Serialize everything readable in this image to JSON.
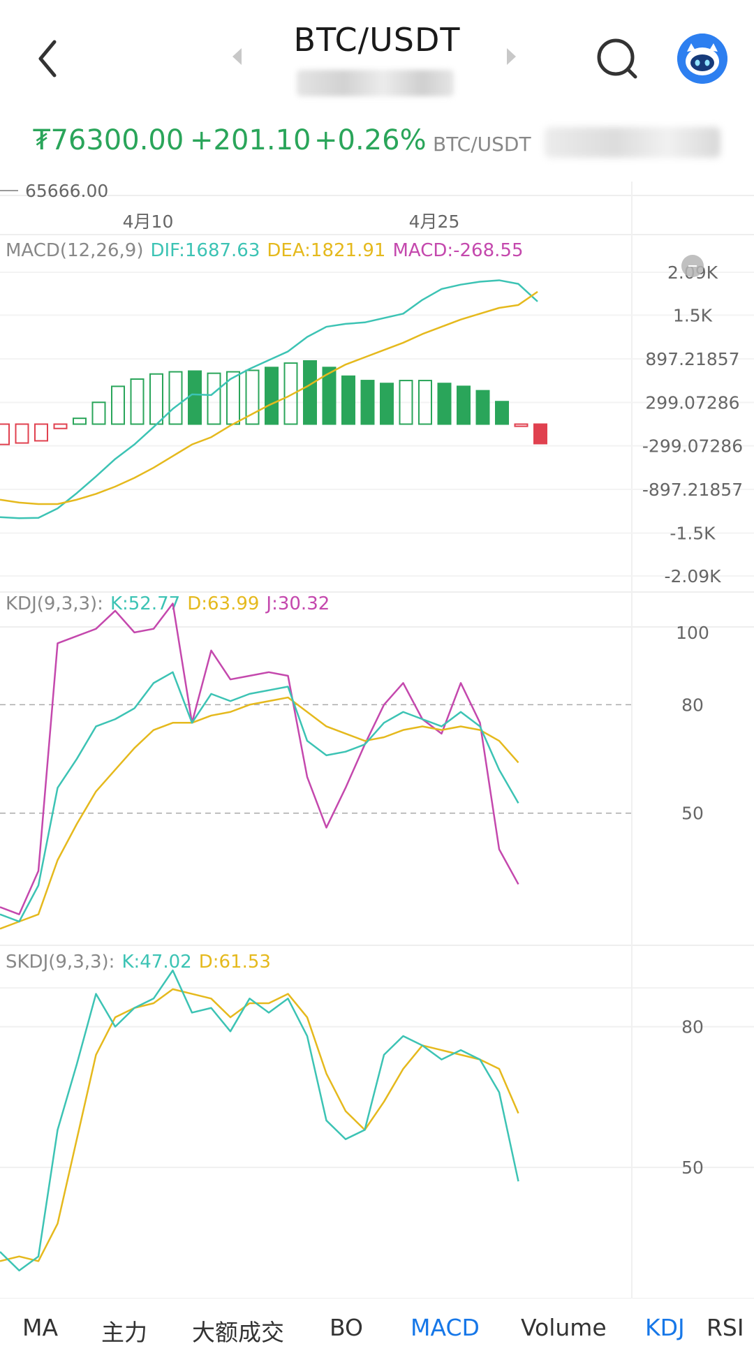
{
  "header": {
    "title": "BTC/USDT"
  },
  "ticker": {
    "price": "₮76300.00",
    "change": "+201.10",
    "change_pct": "+0.26%",
    "pair": "BTC/USDT"
  },
  "colors": {
    "up": "#2aa55a",
    "down": "#e0414f",
    "dif": "#3cc3b4",
    "dea": "#e5b91d",
    "macd": "#c448ad",
    "accent": "#1677e8"
  },
  "price_axis": {
    "low_label": "65666.00"
  },
  "date_axis": [
    "4月10",
    "4月25"
  ],
  "macd_panel": {
    "legend": [
      {
        "text": "MACD(12,26,9)",
        "color": "#888888"
      },
      {
        "text": "DIF:1687.63",
        "color": "#3cc3b4"
      },
      {
        "text": "DEA:1821.91",
        "color": "#e5b91d"
      },
      {
        "text": "MACD:-268.55",
        "color": "#c448ad"
      }
    ],
    "axis_labels": [
      "2.09K",
      "1.5K",
      "897.21857",
      "299.07286",
      "-299.07286",
      "-897.21857",
      "-1.5K",
      "-2.09K"
    ]
  },
  "kdj_panel": {
    "legend": [
      {
        "text": "KDJ(9,3,3):",
        "color": "#888888"
      },
      {
        "text": "K:52.77",
        "color": "#3cc3b4"
      },
      {
        "text": "D:63.99",
        "color": "#e5b91d"
      },
      {
        "text": "J:30.32",
        "color": "#c448ad"
      }
    ],
    "axis_labels": [
      "100",
      "80",
      "50"
    ]
  },
  "skdj_panel": {
    "legend": [
      {
        "text": "SKDJ(9,3,3):",
        "color": "#888888"
      },
      {
        "text": "K:47.02",
        "color": "#3cc3b4"
      },
      {
        "text": "D:61.53",
        "color": "#e5b91d"
      }
    ],
    "axis_labels": [
      "80",
      "50"
    ]
  },
  "chart_data": [
    {
      "type": "bar",
      "title": "",
      "name": "MACD histogram",
      "values": [
        -280,
        -260,
        -230,
        -60,
        80,
        300,
        520,
        620,
        690,
        720,
        730,
        700,
        720,
        740,
        780,
        840,
        870,
        780,
        660,
        600,
        560,
        600,
        600,
        560,
        520,
        460,
        310,
        -30,
        -268.55
      ],
      "filled": [
        false,
        false,
        false,
        false,
        false,
        false,
        false,
        false,
        false,
        false,
        true,
        false,
        false,
        false,
        true,
        false,
        true,
        true,
        true,
        true,
        true,
        false,
        false,
        true,
        true,
        true,
        true,
        false,
        true
      ],
      "ylim": [
        -2090,
        2090
      ]
    },
    {
      "type": "line",
      "series": [
        {
          "name": "DIF",
          "values": [
            -1280,
            -1295,
            -1290,
            -1160,
            -950,
            -720,
            -480,
            -280,
            -40,
            210,
            410,
            400,
            620,
            760,
            880,
            1000,
            1200,
            1340,
            1380,
            1400,
            1460,
            1520,
            1710,
            1860,
            1920,
            1960,
            1980,
            1930,
            1687.63
          ]
        },
        {
          "name": "DEA",
          "values": [
            -1040,
            -1080,
            -1100,
            -1100,
            -1040,
            -960,
            -860,
            -740,
            -600,
            -440,
            -280,
            -180,
            -20,
            120,
            260,
            380,
            520,
            680,
            820,
            920,
            1020,
            1120,
            1240,
            1340,
            1440,
            1520,
            1600,
            1640,
            1821.91
          ]
        }
      ],
      "ylim": [
        -2090,
        2090
      ]
    },
    {
      "type": "line",
      "series": [
        {
          "name": "K",
          "values": [
            22,
            20,
            30,
            57,
            65,
            74,
            76,
            79,
            86,
            89,
            75,
            83,
            81,
            83,
            84,
            85,
            70,
            66,
            67,
            69,
            75,
            78,
            76,
            74,
            78,
            74,
            62,
            52.77
          ]
        },
        {
          "name": "D",
          "values": [
            18,
            20,
            22,
            37,
            47,
            56,
            62,
            68,
            73,
            75,
            75,
            77,
            78,
            80,
            81,
            82,
            78,
            74,
            72,
            70,
            71,
            73,
            74,
            73,
            74,
            73,
            70,
            63.99
          ]
        },
        {
          "name": "J",
          "values": [
            24,
            22,
            34,
            97,
            99,
            101,
            106,
            100,
            101,
            108,
            75,
            95,
            87,
            88,
            89,
            88,
            60,
            46,
            57,
            69,
            80,
            86,
            76,
            72,
            86,
            75,
            40,
            30.32
          ]
        }
      ],
      "ylim": [
        20,
        105
      ]
    },
    {
      "type": "line",
      "series": [
        {
          "name": "K",
          "values": [
            32,
            28,
            31,
            58,
            72,
            87,
            80,
            84,
            86,
            92,
            83,
            84,
            79,
            86,
            83,
            86,
            78,
            60,
            56,
            58,
            74,
            78,
            76,
            73,
            75,
            73,
            66,
            47.02
          ]
        },
        {
          "name": "D",
          "values": [
            30,
            31,
            30,
            38,
            56,
            74,
            82,
            84,
            85,
            88,
            87,
            86,
            82,
            85,
            85,
            87,
            82,
            70,
            62,
            58,
            64,
            71,
            76,
            75,
            74,
            73,
            71,
            61.53
          ]
        }
      ],
      "ylim": [
        25,
        92
      ]
    }
  ],
  "tabs": [
    {
      "label": "MA",
      "active": false
    },
    {
      "label": "主力",
      "active": false
    },
    {
      "label": "大额成交",
      "active": false
    },
    {
      "label": "BO",
      "active": false
    },
    {
      "label": "MACD",
      "active": true
    },
    {
      "label": "Volume",
      "active": false
    },
    {
      "label": "KDJ",
      "active": true
    },
    {
      "label": "RSI",
      "active": false
    }
  ]
}
